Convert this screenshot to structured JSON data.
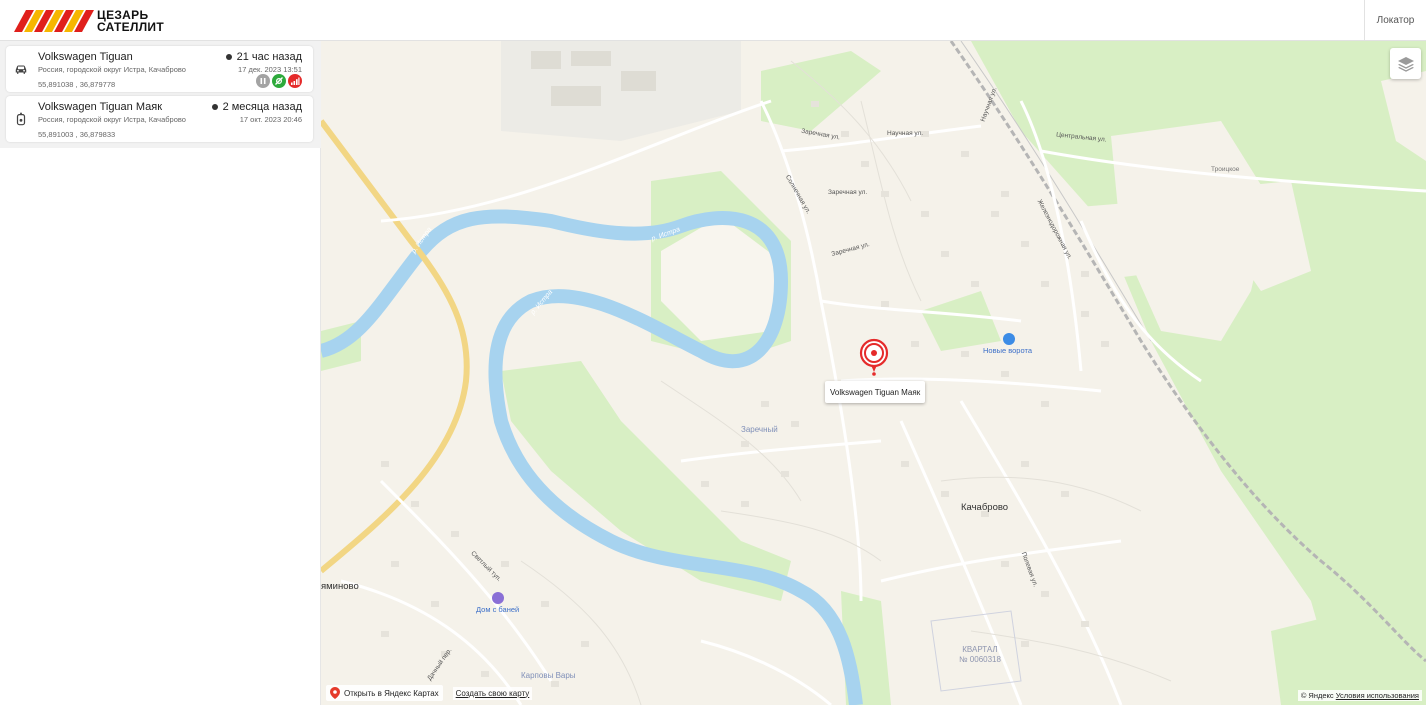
{
  "header": {
    "logo": {
      "line1": "ЦЕЗАРЬ",
      "line2": "САТЕЛЛИТ"
    },
    "locator_label": "Локатор"
  },
  "units": [
    {
      "name": "Volkswagen Tiguan",
      "address": "Россия, городской округ Истра, Качаброво",
      "coords": "55,891038 , 36,879778",
      "ago": "21 час назад",
      "timestamp": "17 дек. 2023 13:51",
      "icon": "car-icon",
      "status_badges": [
        {
          "icon": "pause-icon",
          "color": "#9e9e9e"
        },
        {
          "icon": "no-gps-icon",
          "color": "#2eaa3c"
        },
        {
          "icon": "signal-icon",
          "color": "#e52b2b"
        }
      ]
    },
    {
      "name": "Volkswagen Tiguan Маяк",
      "address": "Россия, городской округ Истра, Качаброво",
      "coords": "55,891003 , 36,879833",
      "ago": "2 месяца назад",
      "timestamp": "17 окт. 2023 20:46",
      "icon": "beacon-icon"
    }
  ],
  "map": {
    "marker_label": "Volkswagen Tiguan Маяк",
    "marker_color": "#e52b2b",
    "open_in_maps": "Открыть в Яндекс Картах",
    "create_map": "Создать свою карту",
    "copyright_prefix": "© Яндекс",
    "terms": "Условия использования",
    "labels": {
      "kachabrovo": "Качаброво",
      "zarechny": "Заречный",
      "yaminovo": "яминово",
      "troitskoe": "Троицкое",
      "novye_vorota": "Новые ворота",
      "dom_s_baney": "Дом с баней",
      "karpovy_vary": "Карповы Вары",
      "kvartal_1": "КВАРТАЛ",
      "kvartal_2": "№ 0060318",
      "river_1": "р. Истра",
      "river_2": "р. Истра",
      "river_3": "р. Истра",
      "zarechnaya_1": "Заречная ул.",
      "zarechnaya_2": "Заречная ул.",
      "zarechnaya_3": "Заречная ул.",
      "nauchnaya_1": "Научная ул.",
      "nauchnaya_2": "Научная ул.",
      "solnechnaya": "Солнечная ул.",
      "tsentralnaya": "Центральная ул.",
      "zheleznodorozhnaya": "Железнодорожная ул.",
      "polevaya": "Полевая ул.",
      "svetly": "Светлый туп.",
      "dachny": "Дачный пер."
    }
  }
}
